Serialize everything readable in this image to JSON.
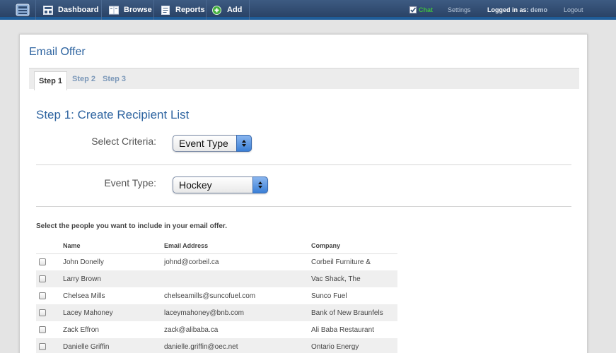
{
  "topbar": {
    "nav": [
      {
        "label": "Dashboard",
        "icon": "dashboard-icon"
      },
      {
        "label": "Browse",
        "icon": "browse-icon"
      },
      {
        "label": "Reports",
        "icon": "reports-icon"
      },
      {
        "label": "Add",
        "icon": "add-icon"
      }
    ],
    "chat_label": "Chat",
    "settings_label": "Settings",
    "logged_in_label": "Logged in as:",
    "username": "demo",
    "logout_label": "Logout"
  },
  "page": {
    "title": "Email Offer",
    "tabs": [
      {
        "label": "Step 1",
        "active": true
      },
      {
        "label": "Step 2",
        "active": false
      },
      {
        "label": "Step 3",
        "active": false
      }
    ],
    "step_heading": "Step 1: Create Recipient List",
    "criteria": {
      "label": "Select Criteria:",
      "value": "Event Type"
    },
    "event_type": {
      "label": "Event Type:",
      "value": "Hockey"
    },
    "instructions": "Select the people you want to include in your email offer.",
    "table": {
      "headers": [
        "Name",
        "Email Address",
        "Company"
      ],
      "rows": [
        {
          "name": "John Donelly",
          "email": "johnd@corbeil.ca",
          "company": "Corbeil Furniture &"
        },
        {
          "name": "Larry Brown",
          "email": "",
          "company": "Vac Shack, The"
        },
        {
          "name": "Chelsea Mills",
          "email": "chelseamills@suncofuel.com",
          "company": "Sunco Fuel"
        },
        {
          "name": "Lacey Mahoney",
          "email": "laceymahoney@bnb.com",
          "company": "Bank of New Braunfels"
        },
        {
          "name": "Zack Effron",
          "email": "zack@alibaba.ca",
          "company": "Ali Baba Restaurant"
        },
        {
          "name": "Danielle Griffin",
          "email": "danielle.griffin@oec.net",
          "company": "Ontario Energy"
        }
      ]
    }
  },
  "colors": {
    "topbar": "#2e4a70",
    "accent_blue": "#2e64a0",
    "chat_green": "#3fbf3f"
  }
}
